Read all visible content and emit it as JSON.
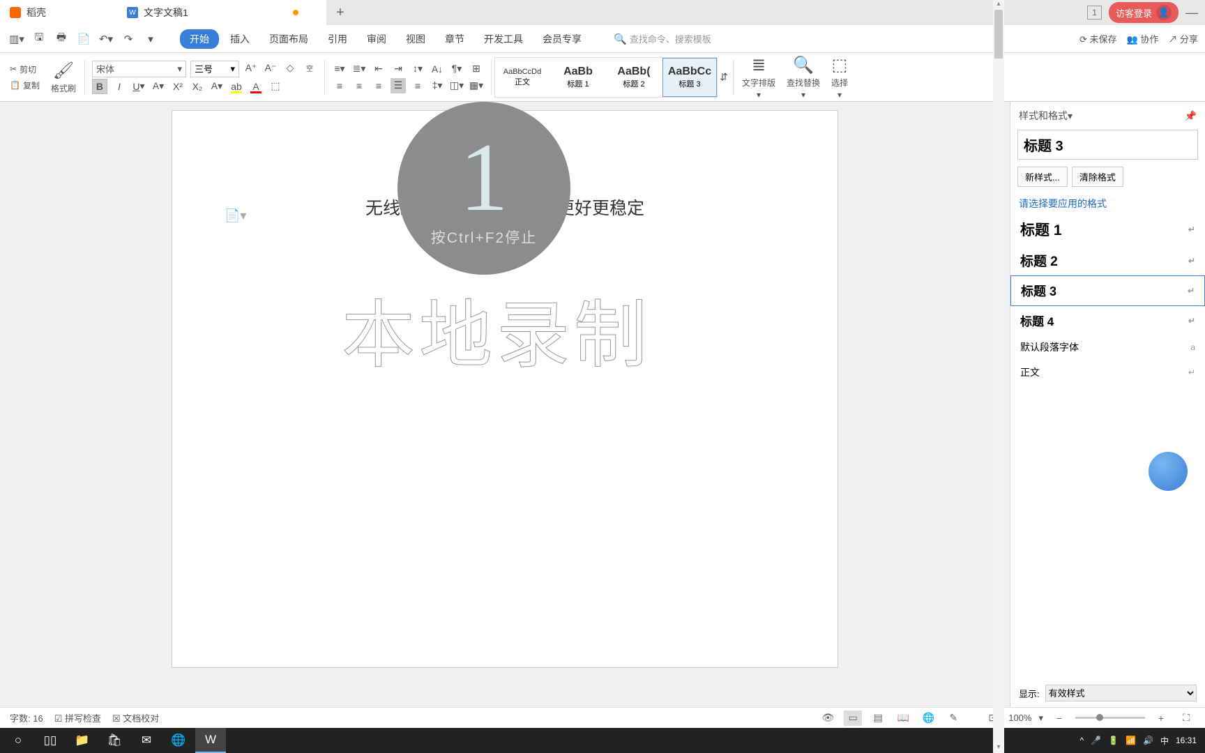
{
  "tabs": {
    "shell": "稻壳",
    "doc": "文字文稿1"
  },
  "title_right": {
    "badge": "1",
    "login": "访客登录"
  },
  "menu": {
    "items": [
      "开始",
      "插入",
      "页面布局",
      "引用",
      "审阅",
      "视图",
      "章节",
      "开发工具",
      "会员专享"
    ],
    "search_placeholder": "查找命令、搜索模板",
    "right": {
      "unsaved": "未保存",
      "collab": "协作",
      "share": "分享"
    }
  },
  "ribbon": {
    "cut": "剪切",
    "copy": "复制",
    "brush": "格式刷",
    "font": "宋体",
    "size": "三号",
    "styles": [
      {
        "prev": "AaBbCcDd",
        "label": "正文"
      },
      {
        "prev": "AaBb",
        "label": "标题 1"
      },
      {
        "prev": "AaBb(",
        "label": "标题 2"
      },
      {
        "prev": "AaBbCc",
        "label": "标题 3"
      }
    ],
    "layout": "文字排版",
    "find": "查找替换",
    "select": "选择"
  },
  "doc": {
    "content": "无线上网和有线上网哪个更好更稳定"
  },
  "overlay": {
    "number": "1",
    "hint": "按Ctrl+F2停止",
    "watermark": "本地录制"
  },
  "side": {
    "title": "样式和格式",
    "current": "标题 3",
    "btn_new": "新样式...",
    "btn_clear": "清除格式",
    "hint": "请选择要应用的格式",
    "list": [
      "标题 1",
      "标题 2",
      "标题 3",
      "标题 4",
      "默认段落字体",
      "正文"
    ],
    "show_label": "显示:",
    "show_value": "有效样式"
  },
  "status": {
    "words_label": "字数:",
    "words": "16",
    "spell": "拼写检查",
    "proof": "文档校对",
    "zoom": "100%"
  },
  "taskbar": {
    "ime": "中",
    "time": "16:31"
  }
}
